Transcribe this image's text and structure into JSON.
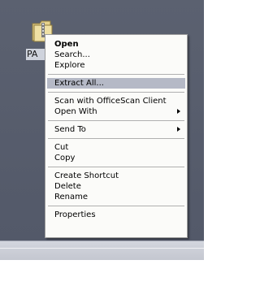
{
  "desktop": {
    "icon": {
      "name": "folder-zip-icon",
      "label": "PA"
    }
  },
  "context_menu": {
    "groups": [
      [
        {
          "label": "Open",
          "bold": true
        },
        {
          "label": "Search..."
        },
        {
          "label": "Explore"
        }
      ],
      [
        {
          "label": "Extract All...",
          "highlighted": true
        }
      ],
      [
        {
          "label": "Scan with OfficeScan Client"
        },
        {
          "label": "Open With",
          "submenu": true
        }
      ],
      [
        {
          "label": "Send To",
          "submenu": true
        }
      ],
      [
        {
          "label": "Cut"
        },
        {
          "label": "Copy"
        }
      ],
      [
        {
          "label": "Create Shortcut"
        },
        {
          "label": "Delete"
        },
        {
          "label": "Rename"
        }
      ],
      [
        {
          "label": "Properties"
        }
      ]
    ]
  },
  "colors": {
    "desktop_bg": "#575d6d",
    "menu_bg": "#fbfbf9",
    "highlight_bg": "#b5b9c6"
  }
}
